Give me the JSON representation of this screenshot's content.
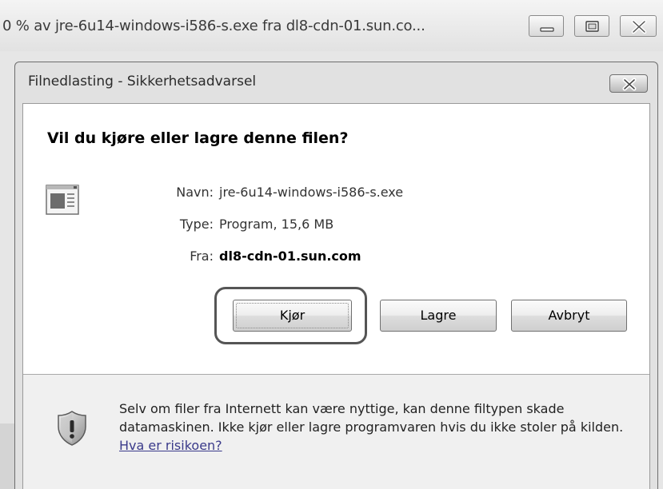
{
  "background_window": {
    "title": "0 % av jre-6u14-windows-i586-s.exe fra dl8-cdn-01.sun.co...",
    "controls": [
      "minimize-icon",
      "maximize-icon",
      "close-icon"
    ]
  },
  "dialog": {
    "title": "Filnedlasting - Sikkerhetsadvarsel",
    "close_icon": "close-icon",
    "question": "Vil du kjøre eller lagre denne filen?",
    "file_icon": "program-file-icon",
    "fields": {
      "name_label": "Navn:",
      "name_value": "jre-6u14-windows-i586-s.exe",
      "type_label": "Type:",
      "type_value": "Program, 15,6 MB",
      "from_label": "Fra:",
      "from_value": "dl8-cdn-01.sun.com"
    },
    "buttons": {
      "run": "Kjør",
      "save": "Lagre",
      "cancel": "Avbryt"
    },
    "warning": {
      "icon": "shield-warning-icon",
      "text": "Selv om filer fra Internett kan være nyttige, kan denne filtypen skade datamaskinen. Ikke kjør eller lagre programvaren hvis du ikke stoler på kilden. ",
      "link": "Hva er risikoen?"
    }
  },
  "colors": {
    "dialog_frame": "#e1e1e1",
    "client_bg": "#ffffff",
    "footer_bg": "#f0f0f0",
    "link": "#3a3a8a"
  }
}
